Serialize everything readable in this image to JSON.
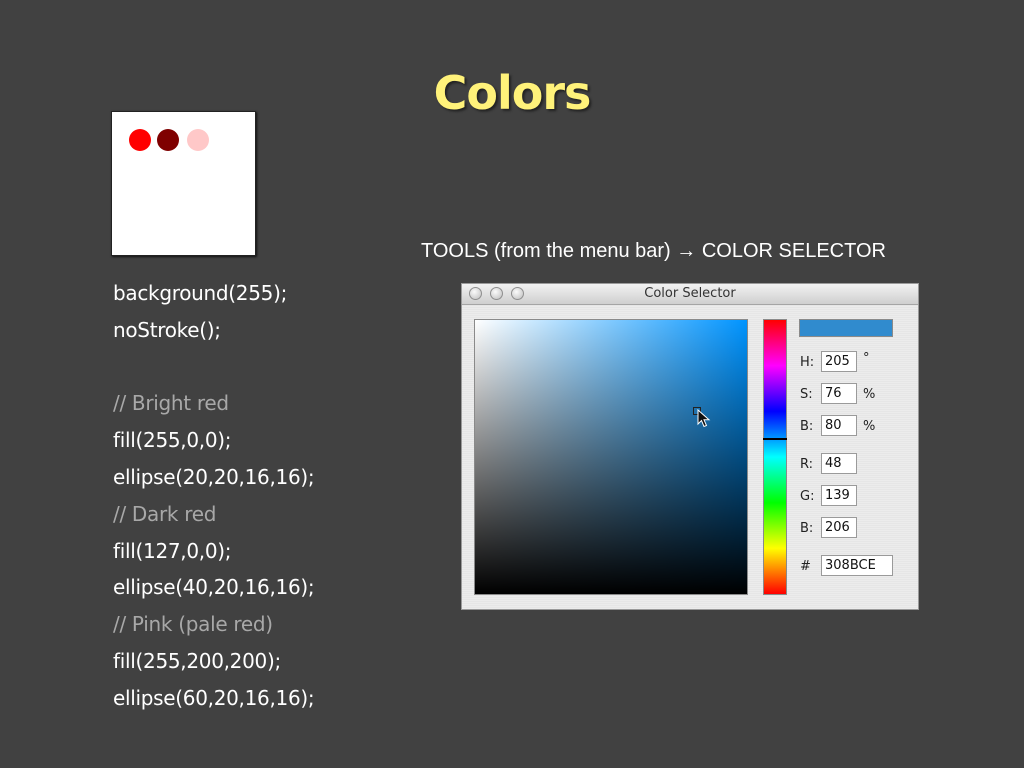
{
  "slide": {
    "title": "Colors",
    "caption": "TOOLS (from the menu bar) → COLOR SELECTOR"
  },
  "sketch": {
    "background": "#ffffff",
    "circles": [
      {
        "name": "bright-red",
        "color": "#ff0000"
      },
      {
        "name": "dark-red",
        "color": "#7f0000"
      },
      {
        "name": "pink",
        "color": "#ffc8c8"
      }
    ]
  },
  "code": {
    "lines": [
      {
        "text": "background(255);",
        "comment": false
      },
      {
        "text": "noStroke();",
        "comment": false
      },
      {
        "text": "",
        "comment": false
      },
      {
        "text": "// Bright red",
        "comment": true
      },
      {
        "text": "fill(255,0,0);",
        "comment": false
      },
      {
        "text": "ellipse(20,20,16,16);",
        "comment": false
      },
      {
        "text": "// Dark red",
        "comment": true
      },
      {
        "text": "fill(127,0,0);",
        "comment": false
      },
      {
        "text": "ellipse(40,20,16,16);",
        "comment": false
      },
      {
        "text": "// Pink (pale red)",
        "comment": true
      },
      {
        "text": "fill(255,200,200);",
        "comment": false
      },
      {
        "text": "ellipse(60,20,16,16);",
        "comment": false
      }
    ]
  },
  "color_selector": {
    "window_title": "Color Selector",
    "selected_color": "#308BCE",
    "hsb": {
      "h_label": "H:",
      "h_value": "205",
      "h_unit": "°",
      "s_label": "S:",
      "s_value": "76",
      "s_unit": "%",
      "b_label": "B:",
      "b_value": "80",
      "b_unit": "%"
    },
    "rgb": {
      "r_label": "R:",
      "r_value": "48",
      "g_label": "G:",
      "g_value": "139",
      "b_label": "B:",
      "b_value": "206"
    },
    "hex_label": "#",
    "hex_value": "308BCE"
  },
  "colors": {
    "background": "#414141",
    "title": "#fff27a",
    "comment": "#a8a8a8"
  }
}
